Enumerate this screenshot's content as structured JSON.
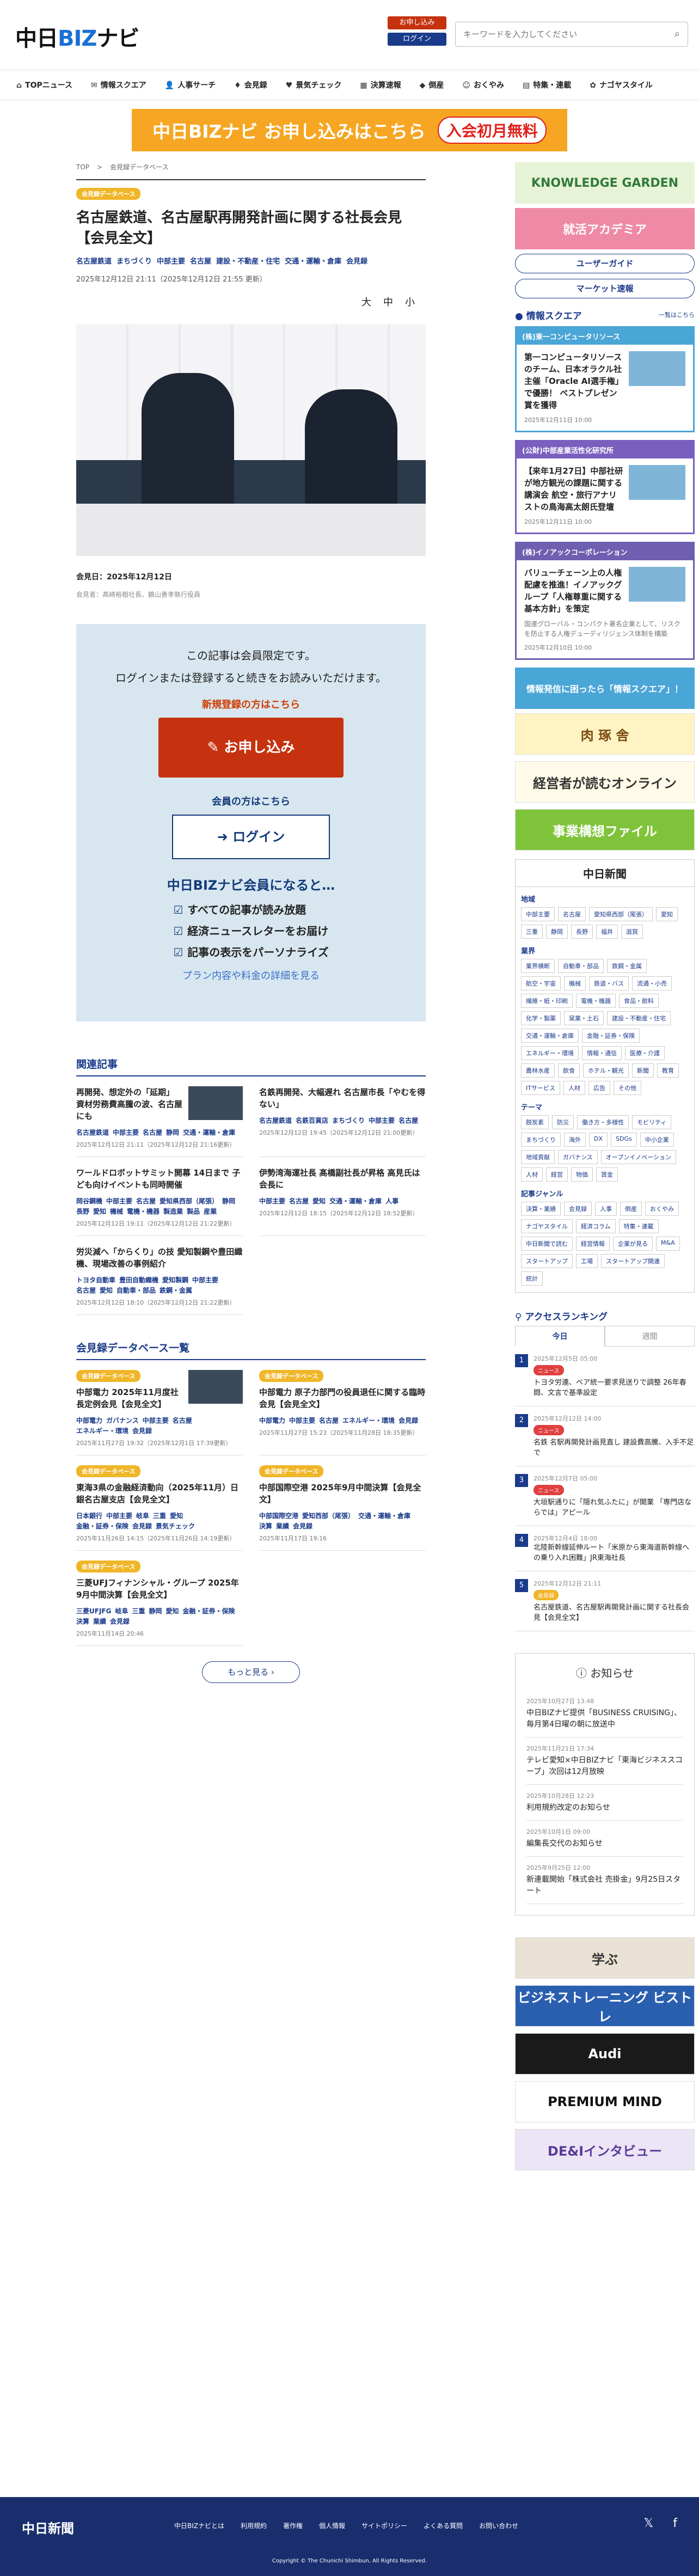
{
  "header": {
    "logo_pre": "中日",
    "logo_biz": "BIZ",
    "logo_post": "ナビ",
    "apply": "お申し込み",
    "login": "ログイン",
    "search_placeholder": "キーワードを入力してください"
  },
  "nav": [
    {
      "icon": "⌂",
      "label": "TOPニュース"
    },
    {
      "icon": "✉",
      "label": "情報スクエア"
    },
    {
      "icon": "👤",
      "label": "人事サーチ"
    },
    {
      "icon": "♦",
      "label": "会見録"
    },
    {
      "icon": "♥",
      "label": "景気チェック"
    },
    {
      "icon": "▦",
      "label": "決算速報"
    },
    {
      "icon": "◆",
      "label": "倒産"
    },
    {
      "icon": "☺",
      "label": "おくやみ"
    },
    {
      "icon": "▤",
      "label": "特集・連載"
    },
    {
      "icon": "✿",
      "label": "ナゴヤスタイル"
    }
  ],
  "banner": {
    "text": "中日BIZナビ お申し込みはこちら",
    "pill": "入会初月無料"
  },
  "crumb": [
    "TOP",
    ">",
    "会見録データベース"
  ],
  "article": {
    "badge": "会見録データベース",
    "title": "名古屋鉄道、名古屋駅再開発計画に関する社長会見【会見全文】",
    "tags": [
      "名古屋鉄道",
      "まちづくり",
      "中部主要",
      "名古屋",
      "建設・不動産・住宅",
      "交通・運輸・倉庫",
      "会見録"
    ],
    "dates": "2025年12月12日 21:11（2025年12月12日 21:55 更新）",
    "font": [
      "大",
      "中",
      "小"
    ],
    "caption": "会見日：2025年12月12日",
    "caption_sub": "会見者：髙崎裕樹社長、鶴山善孝執行役員"
  },
  "paywall": {
    "t1": "この記事は会員限定です。",
    "t2": "ログインまたは登録すると続きをお読みいただけます。",
    "t3": "新規登録の方はこちら",
    "apply": "お申し込み",
    "t4": "会員の方はこちら",
    "login": "ログイン",
    "t5": "中日BIZナビ会員になると…",
    "benefits": [
      "すべての記事が読み放題",
      "経済ニュースレターをお届け",
      "記事の表示をパーソナライズ"
    ],
    "t6": "プラン内容や料金の詳細を見る"
  },
  "related": {
    "heading": "関連記事",
    "items": [
      {
        "title": "再開発、想定外の「延期」 資材労務費高騰の波、名古屋にも",
        "tags": [
          "名古屋鉄道",
          "中部主要",
          "名古屋",
          "静岡",
          "交通・運輸・倉庫"
        ],
        "date": "2025年12月12日 21:11（2025年12月12日 21:16更新）",
        "thumb": true
      },
      {
        "title": "名鉄再開発、大幅遅れ 名古屋市長「やむを得ない」",
        "tags": [
          "名古屋鉄道",
          "名鉄百貨店",
          "まちづくり",
          "中部主要",
          "名古屋"
        ],
        "date": "2025年12月12日 19:45（2025年12月12日 21:00更新）",
        "thumb": false
      },
      {
        "title": "ワールドロボットサミット開幕 14日まで 子ども向けイベントも同時開催",
        "tags": [
          "岡谷鋼機",
          "中部主要",
          "名古屋",
          "愛知県西部（尾張）",
          "静岡",
          "長野",
          "愛知",
          "機械",
          "電機・機器",
          "製造業",
          "製品",
          "産業"
        ],
        "date": "2025年12月12日 19:11（2025年12月12日 21:22更新）",
        "thumb": false
      },
      {
        "title": "伊勢湾海運社長 髙橋副社長が昇格 高見氏は会長に",
        "tags": [
          "中部主要",
          "名古屋",
          "愛知",
          "交通・運輸・倉庫",
          "人事"
        ],
        "date": "2025年12月12日 18:15（2025年12月12日 18:52更新）",
        "thumb": false
      },
      {
        "title": "労災減へ「からくり」の技 愛知製鋼や豊田織機、現場改善の事例紹介",
        "tags": [
          "トヨタ自動車",
          "豊田自動織機",
          "愛知製鋼",
          "中部主要",
          "名古屋",
          "愛知",
          "自動車・部品",
          "鉄鋼・金属"
        ],
        "date": "2025年12月12日 18:10（2025年12月12日 21:22更新）",
        "thumb": false
      }
    ]
  },
  "press": {
    "heading": "会見録データベース一覧",
    "more": "もっと見る",
    "items": [
      {
        "badge": "会見録データベース",
        "title": "中部電力 2025年11月度社長定例会見【会見全文】",
        "tags": [
          "中部電力",
          "ガバナンス",
          "中部主要",
          "名古屋",
          "エネルギー・環境",
          "会見録"
        ],
        "date": "2025年11月27日 19:32（2025年12月1日 17:39更新）",
        "thumb": true
      },
      {
        "badge": "会見録データベース",
        "title": "中部電力 原子力部門の役員退任に関する臨時会見【会見全文】",
        "tags": [
          "中部電力",
          "中部主要",
          "名古屋",
          "エネルギー・環境",
          "会見録"
        ],
        "date": "2025年11月27日 15:23（2025年11月28日 18:35更新）",
        "thumb": false
      },
      {
        "badge": "会見録データベース",
        "title": "東海3県の金融経済動向（2025年11月）日銀名古屋支店【会見全文】",
        "tags": [
          "日本銀行",
          "中部主要",
          "岐阜",
          "三重",
          "愛知",
          "金融・証券・保険",
          "会見録",
          "景気チェック"
        ],
        "date": "2025年11月26日 14:15（2025年11月26日 14:19更新）",
        "thumb": false
      },
      {
        "badge": "会見録データベース",
        "title": "中部国際空港 2025年9月中間決算【会見全文】",
        "tags": [
          "中部国際空港",
          "愛知西部（尾張）",
          "交通・運輸・倉庫",
          "決算",
          "業績",
          "会見録"
        ],
        "date": "2025年11月17日 19:16",
        "thumb": false
      },
      {
        "badge": "会見録データベース",
        "title": "三菱UFJフィナンシャル・グループ 2025年9月中間決算【会見全文】",
        "tags": [
          "三菱UFJFG",
          "岐阜",
          "三重",
          "静岡",
          "愛知",
          "金融・証券・保険",
          "決算",
          "業績",
          "会見録"
        ],
        "date": "2025年11月14日 20:46",
        "thumb": false
      }
    ]
  },
  "side": {
    "banners": [
      {
        "text": "KNOWLEDGE GARDEN",
        "bg": "#e7f3d6",
        "fg": "#2f7a3a"
      },
      {
        "text": "就活アカデミア",
        "bg": "#ee8aa6",
        "fg": "#fff"
      }
    ],
    "buttons": [
      "ユーザーガイド",
      "マーケット速報"
    ],
    "square_heading": "情報スクエア",
    "square_more": "一覧はこちら",
    "square": [
      {
        "company": "(株)東一コンピュータリソース",
        "title": "第一コンピュータリソースのチーム、日本オラクル社主催「Oracle AI選手権」で優勝！ ベストプレゼン賞を獲得",
        "desc": "",
        "date": "2025年12月11日 10:00"
      },
      {
        "company": "(公財)中部産業活性化研究所",
        "title": "【来年1月27日】中部社研が地方観光の課題に関する講演会 航空・旅行アナリストの鳥海高太朗氏登壇",
        "desc": "",
        "date": "2025年12月11日 10:00"
      },
      {
        "company": "(株)イノアックコーポレーション",
        "title": "バリューチェーン上の人権配慮を推進！イノアックグループ「人権尊重に関する基本方針」を策定",
        "desc": "国連グローバル・コンパクト署名企業として、リスクを防止する人権デューディリジェンス体制を構築",
        "date": "2025年12月10日 10:00"
      }
    ],
    "info_banner": "情報発信に困ったら「情報スクエア」！",
    "ads": [
      {
        "text": "肉 琢 舎",
        "bg": "#fff3c4",
        "fg": "#7a4a10"
      },
      {
        "text": "経営者が読むオンライン",
        "bg": "#fffbe8",
        "fg": "#333"
      },
      {
        "text": "事業構想ファイル",
        "bg": "#7fc33a",
        "fg": "#fff"
      }
    ],
    "chunichi": "中日新聞",
    "cats": [
      {
        "h": "地域",
        "items": [
          "中部主要",
          "名古屋",
          "愛知県西部（尾張）",
          "愛知",
          "三重",
          "静岡",
          "長野",
          "福井",
          "滋賀"
        ]
      },
      {
        "h": "業界",
        "items": [
          "業界横断",
          "自動車・部品",
          "鉄鋼・金属",
          "航空・宇宙",
          "機械",
          "鉄道・バス",
          "流通・小売",
          "繊維・紙・印刷",
          "電機・機器",
          "食品・飲料",
          "化学・製薬",
          "窯業・土石",
          "建設・不動産・住宅",
          "交通・運輸・倉庫",
          "金融・証券・保険",
          "エネルギー・環境",
          "情報・通信",
          "医療・介護",
          "農林水産",
          "飲食",
          "ホテル・観光",
          "新聞",
          "教育",
          "ITサービス",
          "人材",
          "広告",
          "その他"
        ]
      },
      {
        "h": "テーマ",
        "items": [
          "脱炭素",
          "防災",
          "働き方・多様性",
          "モビリティ",
          "まちづくり",
          "海外",
          "DX",
          "SDGs",
          "中小企業",
          "地域貢献",
          "ガバナンス",
          "オープンイノベーション",
          "人材",
          "経営",
          "物価",
          "賃金"
        ]
      },
      {
        "h": "記事ジャンル",
        "items": [
          "決算・業績",
          "会見録",
          "人事",
          "倒産",
          "おくやみ",
          "ナゴヤスタイル",
          "経済コラム",
          "特集・連載",
          "中日新聞で読む",
          "経営情報",
          "企業が見る",
          "M&A",
          "スタートアップ",
          "工場",
          "スタートアップ関連",
          "統計"
        ]
      }
    ],
    "rank": {
      "heading": "アクセスランキング",
      "tabs": [
        "今日",
        "週間"
      ],
      "items": [
        {
          "date": "2025年12月5日 05:00",
          "badge": "ニュース",
          "title": "トヨタ労連、ベア統一要求見送りで調整 26年春闘、文言で基準設定"
        },
        {
          "date": "2025年12月12日 14:00",
          "badge": "ニュース",
          "title": "名鉄 名駅再開発計画見直し 建設費高騰、入手不足で"
        },
        {
          "date": "2025年12月7日 05:00",
          "badge": "ニュース",
          "title": "大垣駅通りに「隠れ気ふたに」が開業 「専門店ならでは」アピール"
        },
        {
          "date": "2025年12月4日 18:00",
          "badge": "",
          "title": "北陸新幹線延伸ルート「米原から東海道新幹線への乗り入れ困難」JR東海社長"
        },
        {
          "date": "2025年12月12日 21:11",
          "badge": "会見録",
          "title": "名古屋鉄道、名古屋駅再開発計画に関する社長会見【会見全文】"
        }
      ]
    },
    "notice": {
      "heading": "お知らせ",
      "items": [
        {
          "date": "2025年10月27日 13:48",
          "title": "中日BIZナビ提供「BUSINESS CRUISING」、毎月第4日曜の朝に放送中"
        },
        {
          "date": "2025年11月21日 17:34",
          "title": "テレビ愛知×中日BIZナビ「東海ビジネススコープ」次回は12月放映"
        },
        {
          "date": "2025年10月28日 12:23",
          "title": "利用規約改定のお知らせ"
        },
        {
          "date": "2025年10月1日 09:00",
          "title": "編集長交代のお知らせ"
        },
        {
          "date": "2025年9月25日 12:00",
          "title": "新連載開始「株式会社 売掛金」9月25日スタート"
        }
      ]
    },
    "ads2": [
      {
        "text": "学ぶ",
        "bg": "#e9e2d4",
        "fg": "#333"
      },
      {
        "text": "ビジネストレーニング ビストレ",
        "bg": "#2a5fb0",
        "fg": "#fff"
      },
      {
        "text": "Audi",
        "bg": "#1a1a1a",
        "fg": "#fff"
      },
      {
        "text": "PREMIUM MIND",
        "bg": "#fff",
        "fg": "#111"
      },
      {
        "text": "DE&Iインタビュー",
        "bg": "#ece5f5",
        "fg": "#5a3a9a"
      }
    ]
  },
  "footer": {
    "logo": "中日新聞",
    "links": [
      "中日BIZナビとは",
      "利用規約",
      "著作権",
      "個人情報",
      "サイトポリシー",
      "よくある質問",
      "お問い合わせ"
    ],
    "copy": "Copyright © The Chunichi Shimbun, All Rights Reserved."
  },
  "colors": {
    "navy": "#1a3a8a",
    "orange": "#f6a623",
    "red": "#c6320f"
  }
}
